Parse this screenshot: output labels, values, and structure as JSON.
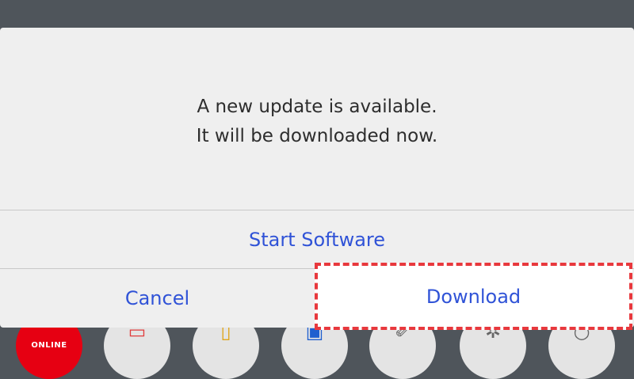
{
  "dialog": {
    "message_line1": "A new update is available.",
    "message_line2": "It will be downloaded now.",
    "start_software_label": "Start Software",
    "cancel_label": "Cancel",
    "download_label": "Download",
    "accent_color": "#3053d7",
    "highlight_color": "#e8383d"
  },
  "home_menu": {
    "icons": [
      {
        "name": "nintendo-switch-online-icon",
        "label": "ONLINE"
      },
      {
        "name": "news-icon"
      },
      {
        "name": "eshop-icon"
      },
      {
        "name": "album-icon"
      },
      {
        "name": "controllers-icon"
      },
      {
        "name": "system-settings-icon"
      },
      {
        "name": "power-icon"
      }
    ]
  }
}
